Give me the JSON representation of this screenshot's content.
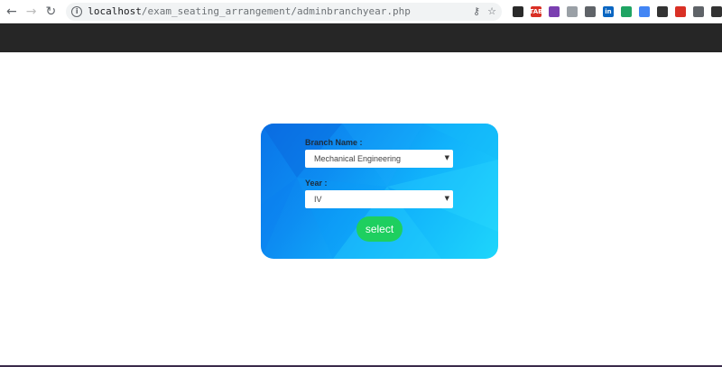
{
  "browser": {
    "url_host": "localhost",
    "url_path": "/exam_seating_arrangement/adminbranchyear.php",
    "extensions": [
      {
        "name": "evernote-icon",
        "color": "#2a2a2a"
      },
      {
        "name": "tab-badge-icon",
        "color": "#d93025",
        "text": "TAB"
      },
      {
        "name": "block-icon",
        "color": "#7a3fb0"
      },
      {
        "name": "page-icon",
        "color": "#9aa0a6"
      },
      {
        "name": "shield-icon",
        "color": "#5f6368"
      },
      {
        "name": "linkedin-icon",
        "color": "#0a66c2",
        "text": "in"
      },
      {
        "name": "drive-icon",
        "color": "#1fa463"
      },
      {
        "name": "pen-icon",
        "color": "#4285f4"
      },
      {
        "name": "bird-icon",
        "color": "#333333"
      },
      {
        "name": "flag-icon",
        "color": "#d93025"
      },
      {
        "name": "grid-icon",
        "color": "#5f6368"
      },
      {
        "name": "mask-icon",
        "color": "#333333"
      }
    ]
  },
  "form": {
    "branch_label": "Branch Name :",
    "branch_value": "Mechanical Engineering",
    "year_label": "Year :",
    "year_value": "IV",
    "submit_label": "select"
  },
  "colors": {
    "header": "#262626",
    "card_start": "#0a74e8",
    "card_end": "#1ed6fb",
    "button": "#1ecf5f"
  }
}
